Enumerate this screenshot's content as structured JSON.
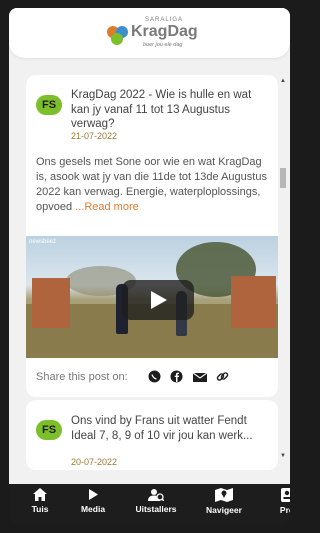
{
  "header": {
    "brand_small": "SARALIGA",
    "brand": "KragDag",
    "tagline": "boer jou eie dag"
  },
  "posts": [
    {
      "badge": "FS",
      "title": "KragDag 2022 - Wie is hulle en wat kan jy vanaf 11 tot 13 Augustus verwag?",
      "date": "21-07-2022",
      "excerpt": "Ons gesels met Sone oor wie en wat KragDag is, asook wat jy van die 11de tot 13de Augustus 2022 kan verwag. Energie, waterploplossings, opvoed",
      "read_more": "...Read more",
      "video_logo": "newsbeez",
      "share_label": "Share this post on:"
    },
    {
      "badge": "FS",
      "title": "Ons vind by Frans uit watter Fendt Ideal 7, 8, 9 of 10 vir jou kan werk...",
      "date": "20-07-2022"
    }
  ],
  "share_icons": [
    "whatsapp-icon",
    "facebook-icon",
    "email-icon",
    "link-icon"
  ],
  "nav": [
    {
      "label": "Tuis",
      "icon": "home-icon"
    },
    {
      "label": "Media",
      "icon": "play-icon"
    },
    {
      "label": "Uitstallers",
      "icon": "people-icon"
    },
    {
      "label": "Navigeer",
      "icon": "map-icon"
    },
    {
      "label": "Pro",
      "icon": "profile-icon"
    }
  ],
  "colors": {
    "accent": "#e07b2a",
    "badge": "#7cbf2a",
    "nav_bg": "#1d1d1d"
  }
}
